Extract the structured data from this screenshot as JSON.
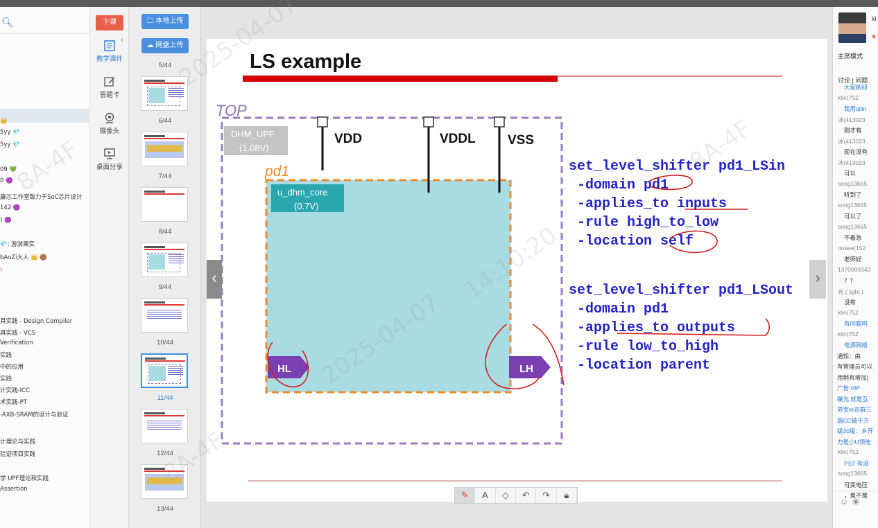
{
  "left_panel": {
    "lines": [
      {
        "text": "👑",
        "cls": "gold"
      },
      {
        "text": "5yy 💎",
        "cls": ""
      },
      {
        "text": "5yy 💎",
        "cls": ""
      },
      {
        "text": "09 💚",
        "cls": ""
      },
      {
        "text": "0 🟣",
        "cls": ""
      },
      {
        "text": "康芯工作室致力于SoC芯片设计",
        "cls": "gray"
      },
      {
        "text": "142 🟣",
        "cls": ""
      },
      {
        "text": ") 🟣",
        "cls": ""
      },
      {
        "text": "💎: 游游果实",
        "cls": "gray"
      },
      {
        "text": " bAoZi大人 👑 🟤",
        "cls": ""
      },
      {
        "text": "!",
        "cls": "red"
      },
      {
        "text": "具实践 - Design Compiler",
        "cls": ""
      },
      {
        "text": "具实践 - VCS",
        "cls": ""
      },
      {
        "text": "Verification",
        "cls": ""
      },
      {
        "text": "实践",
        "cls": ""
      },
      {
        "text": "中的应用",
        "cls": ""
      },
      {
        "text": "实践",
        "cls": ""
      },
      {
        "text": "计实践-ICC",
        "cls": ""
      },
      {
        "text": "术实践-PT",
        "cls": ""
      },
      {
        "text": "-AXB-SRAM的设计与验证",
        "cls": ""
      },
      {
        "text": "计理论与实践",
        "cls": ""
      },
      {
        "text": "验证项目实践",
        "cls": ""
      },
      {
        "text": "学 UPF理论和实践",
        "cls": ""
      },
      {
        "text": "Assertion",
        "cls": ""
      }
    ]
  },
  "toolbar": {
    "class_end": "下课",
    "items": [
      {
        "label": "教学课件"
      },
      {
        "label": "答题卡"
      },
      {
        "label": "摄像头"
      },
      {
        "label": "桌面分享"
      }
    ]
  },
  "thumbs": {
    "local_upload": "本地上传",
    "cloud_upload": "网盘上传",
    "labels": [
      "5/44",
      "6/44",
      "7/44",
      "8/44",
      "9/44",
      "10/44",
      "11/44",
      "12/44",
      "13/44"
    ]
  },
  "slide": {
    "title": "LS example",
    "top_label": "TOP",
    "upf_box": [
      "DHM_UPF",
      "(1.08V)"
    ],
    "pd_label": "pd1",
    "core_box": [
      "u_dhm_core",
      "(0.7V)"
    ],
    "pins": [
      "VDD",
      "VDDL",
      "VSS"
    ],
    "shifters": [
      "HL",
      "LH"
    ],
    "code": [
      "set_level_shifter pd1_LSin",
      " -domain pd1",
      " -applies_to inputs",
      " -rule high_to_low",
      " -location self",
      "set_level_shifter pd1_LSout",
      " -domain pd1",
      " -applies_to outputs",
      " -rule low_to_high",
      " -location parent"
    ],
    "watermark_date": "2025-04-07",
    "watermark_time": "14:10:20",
    "watermark_code": "8A-4F"
  },
  "draw_tools": [
    "pen",
    "text",
    "eraser",
    "undo",
    "redo",
    "lock"
  ],
  "right_panel": {
    "name": "ki",
    "mode": "主席模式",
    "tabs": "讨论 | 问题",
    "lines": [
      {
        "t": "大家刷研",
        "c": "blue"
      },
      {
        "t": "klin(752",
        "c": "user"
      },
      {
        "t": "我用qilin",
        "c": "blue"
      },
      {
        "t": "冰(413023",
        "c": "user"
      },
      {
        "t": "刚才有",
        "c": "msg"
      },
      {
        "t": "冰(413023",
        "c": "user"
      },
      {
        "t": "现在没有",
        "c": "msg"
      },
      {
        "t": "冰(413023",
        "c": "user"
      },
      {
        "t": "可以",
        "c": "msg"
      },
      {
        "t": "song13665",
        "c": "user"
      },
      {
        "t": "听到了",
        "c": "msg"
      },
      {
        "t": "song13665",
        "c": "user"
      },
      {
        "t": "可以了",
        "c": "msg"
      },
      {
        "t": "song13665",
        "c": "user"
      },
      {
        "t": "不着急",
        "c": "msg"
      },
      {
        "t": "ousee(152",
        "c": "user"
      },
      {
        "t": "老师好",
        "c": "msg"
      },
      {
        "t": "1370089343",
        "c": "user"
      },
      {
        "t": "？？",
        "c": "msg"
      },
      {
        "t": "光 ( light )",
        "c": "user"
      },
      {
        "t": "没有",
        "c": "msg"
      },
      {
        "t": "klin(752",
        "c": "user"
      },
      {
        "t": "有问题吗",
        "c": "blue"
      },
      {
        "t": "klin(752",
        "c": "user"
      },
      {
        "t": "电源网络",
        "c": "blue"
      },
      {
        "t": "通知：由",
        "c": "dark"
      },
      {
        "t": "有管理员可以",
        "c": "dark"
      },
      {
        "t": "用稍有增加]",
        "c": "dark"
      },
      {
        "t": "广告:VIP",
        "c": "adv"
      },
      {
        "t": "曝光,就是互",
        "c": "adv"
      },
      {
        "t": "男宝er进群三",
        "c": "adv"
      },
      {
        "t": "瑞CC破千万",
        "c": "adv"
      },
      {
        "t": "级20级：乡开",
        "c": "adv"
      },
      {
        "t": "力是小U领他",
        "c": "adv"
      },
      {
        "t": "klin(752",
        "c": "user"
      },
      {
        "t": "PST 有没",
        "c": "blue"
      },
      {
        "t": "song13665",
        "c": "user"
      },
      {
        "t": "可变电压",
        "c": "msg"
      },
      {
        "t": "，是不是",
        "c": "msg"
      }
    ]
  },
  "colors": {
    "accent_blue": "#2d7fd6",
    "class_end_red": "#e8604a",
    "code_blue": "#2323c8",
    "core_fill": "#a9dbe2",
    "domain_orange": "#f08a26",
    "top_purple": "#9a7bc0",
    "shifter_purple": "#7a3fb0",
    "title_red": "#d40000"
  }
}
